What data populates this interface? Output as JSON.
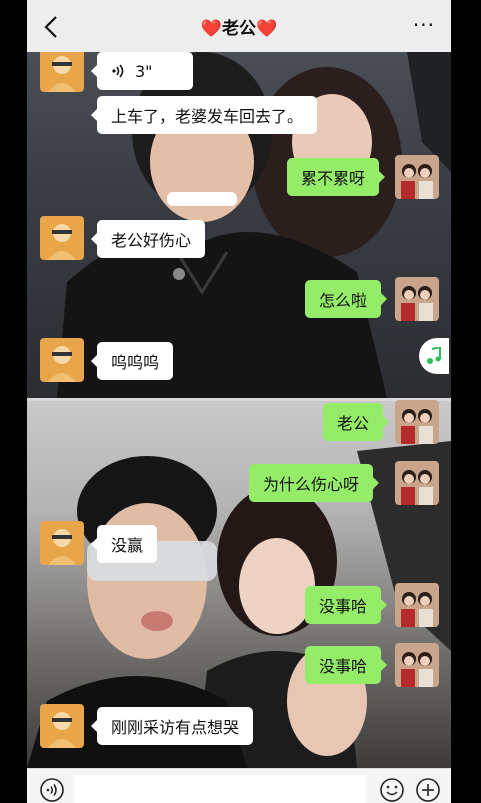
{
  "header": {
    "title": "❤️老公❤️",
    "back_icon": "chevron-left-icon",
    "more_label": "···"
  },
  "messages": [
    {
      "side": "left",
      "type": "voice",
      "text": "3\""
    },
    {
      "side": "left",
      "type": "text",
      "text": "上车了，老婆发车回去了。"
    },
    {
      "side": "right",
      "type": "text",
      "text": "累不累呀"
    },
    {
      "side": "left",
      "type": "text",
      "text": "老公好伤心"
    },
    {
      "side": "right",
      "type": "text",
      "text": "怎么啦"
    },
    {
      "side": "left",
      "type": "text",
      "text": "呜呜呜"
    },
    {
      "side": "right",
      "type": "text",
      "text": "老公"
    },
    {
      "side": "right",
      "type": "text",
      "text": "为什么伤心呀"
    },
    {
      "side": "left",
      "type": "text",
      "text": "没赢"
    },
    {
      "side": "right",
      "type": "text",
      "text": "没事哈"
    },
    {
      "side": "right",
      "type": "text",
      "text": "没事哈"
    },
    {
      "side": "left",
      "type": "text",
      "text": "刚刚采访有点想哭"
    }
  ],
  "colors": {
    "self_bubble": "#95ec69",
    "other_bubble": "#ffffff",
    "header_bg": "#ededed"
  },
  "footer": {
    "voice_icon": "voice-icon",
    "emoji_icon": "emoji-icon",
    "add_icon": "plus-icon"
  },
  "floating": {
    "music_icon": "music-note-icon"
  }
}
